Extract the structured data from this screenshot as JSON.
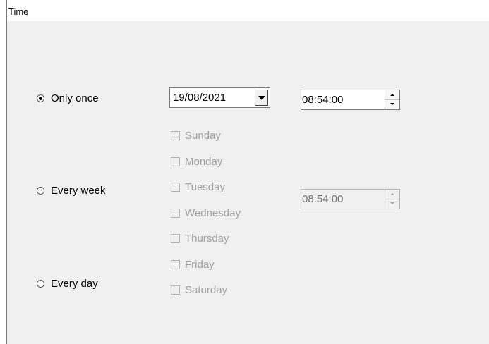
{
  "section": {
    "title": "Time"
  },
  "schedule": {
    "options": [
      {
        "label": "Only once",
        "selected": true
      },
      {
        "label": "Every week",
        "selected": false
      },
      {
        "label": "Every day",
        "selected": false
      }
    ]
  },
  "once": {
    "date_value": "19/08/2021",
    "time_value": "08:54:00"
  },
  "weekly": {
    "time_value": "08:54:00",
    "days": [
      {
        "label": "Sunday",
        "checked": false,
        "enabled": false
      },
      {
        "label": "Monday",
        "checked": false,
        "enabled": false
      },
      {
        "label": "Tuesday",
        "checked": false,
        "enabled": false
      },
      {
        "label": "Wednesday",
        "checked": false,
        "enabled": false
      },
      {
        "label": "Thursday",
        "checked": false,
        "enabled": false
      },
      {
        "label": "Friday",
        "checked": false,
        "enabled": false
      },
      {
        "label": "Saturday",
        "checked": false,
        "enabled": false
      }
    ]
  },
  "icons": {
    "dropdown": "chevron-down-icon",
    "spin_up": "spin-up-icon",
    "spin_down": "spin-down-icon"
  },
  "colors": {
    "panel_background": "#f0f0f0",
    "disabled_text": "#a0a0a0"
  }
}
